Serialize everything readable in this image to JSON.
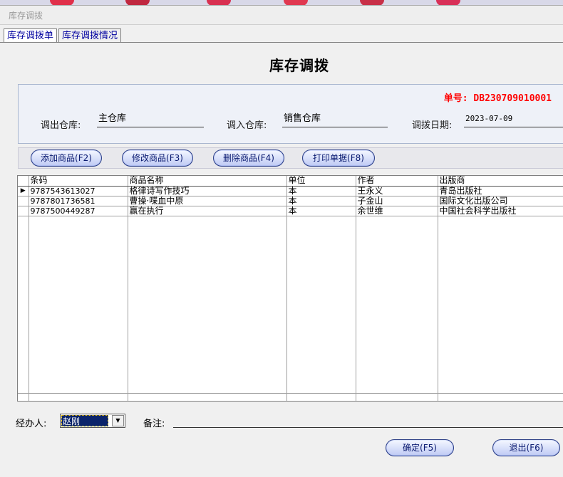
{
  "window": {
    "title": "库存调拨"
  },
  "tabs": [
    {
      "label": "库存调拨单",
      "active": true
    },
    {
      "label": "库存调拨情况",
      "active": false
    }
  ],
  "heading": "库存调拨",
  "order": {
    "no_label": "单号:",
    "no_value": "DB230709010001",
    "out_label": "调出仓库:",
    "out_value": "主仓库",
    "in_label": "调入仓库:",
    "in_value": "销售仓库",
    "date_label": "调拨日期:",
    "date_value": "2023-07-09"
  },
  "actions": {
    "add": "添加商品(F2)",
    "edit": "修改商品(F3)",
    "delete": "删除商品(F4)",
    "print": "打印单据(F8)"
  },
  "grid": {
    "columns": [
      "条码",
      "商品名称",
      "单位",
      "作者",
      "出版商"
    ],
    "rows": [
      [
        "9787543613027",
        "格律诗写作技巧",
        "本",
        "王永义",
        "青岛出版社"
      ],
      [
        "9787801736581",
        "曹操·喋血中原",
        "本",
        "子金山",
        "国际文化出版公司"
      ],
      [
        "9787500449287",
        "赢在执行",
        "本",
        "余世维",
        "中国社会科学出版社"
      ]
    ],
    "current_row_indicator": "▶"
  },
  "footer": {
    "handler_label": "经办人:",
    "handler_value": "赵刚",
    "remark_label": "备注:",
    "remark_value": "",
    "ok": "确定(F5)",
    "exit": "退出(F6)"
  },
  "colors": {
    "docno": "#ff0000",
    "button_text": "#0a1a70",
    "tab_text": "#0000a0"
  }
}
